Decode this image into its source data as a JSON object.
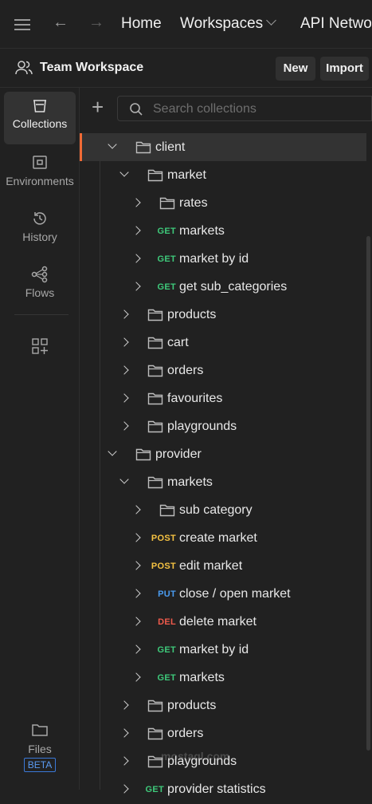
{
  "topbar": {
    "home": "Home",
    "workspaces": "Workspaces",
    "api_network": "API Network"
  },
  "workspace": {
    "name": "Team Workspace",
    "new_label": "New",
    "import_label": "Import"
  },
  "sidebar": {
    "items": [
      {
        "label": "Collections",
        "icon": "collections-icon"
      },
      {
        "label": "Environments",
        "icon": "environments-icon"
      },
      {
        "label": "History",
        "icon": "history-icon"
      },
      {
        "label": "Flows",
        "icon": "flows-icon"
      }
    ],
    "files_label": "Files",
    "beta_label": "BETA"
  },
  "search": {
    "placeholder": "Search collections"
  },
  "colors": {
    "accent": "#f06a35",
    "get": "#3ec97a",
    "post": "#f5c242",
    "put": "#4a9cf0",
    "del": "#ef5a4c"
  },
  "tree": [
    {
      "label": "client",
      "level": 0,
      "type": "folder",
      "expanded": true,
      "selected": true
    },
    {
      "label": "market",
      "level": 1,
      "type": "folder",
      "expanded": true
    },
    {
      "label": "rates",
      "level": 2,
      "type": "folder",
      "expanded": false
    },
    {
      "label": "markets",
      "level": 2,
      "type": "request",
      "method": "GET"
    },
    {
      "label": "market by id",
      "level": 2,
      "type": "request",
      "method": "GET"
    },
    {
      "label": "get sub_categories",
      "level": 2,
      "type": "request",
      "method": "GET"
    },
    {
      "label": "products",
      "level": 1,
      "type": "folder",
      "expanded": false
    },
    {
      "label": "cart",
      "level": 1,
      "type": "folder",
      "expanded": false
    },
    {
      "label": "orders",
      "level": 1,
      "type": "folder",
      "expanded": false
    },
    {
      "label": "favourites",
      "level": 1,
      "type": "folder",
      "expanded": false
    },
    {
      "label": "playgrounds",
      "level": 1,
      "type": "folder",
      "expanded": false
    },
    {
      "label": "provider",
      "level": 0,
      "type": "folder",
      "expanded": true
    },
    {
      "label": "markets",
      "level": 1,
      "type": "folder",
      "expanded": true
    },
    {
      "label": "sub category",
      "level": 2,
      "type": "folder",
      "expanded": false
    },
    {
      "label": "create market",
      "level": 2,
      "type": "request",
      "method": "POST"
    },
    {
      "label": "edit market",
      "level": 2,
      "type": "request",
      "method": "POST"
    },
    {
      "label": "close / open market",
      "level": 2,
      "type": "request",
      "method": "PUT"
    },
    {
      "label": "delete market",
      "level": 2,
      "type": "request",
      "method": "DEL"
    },
    {
      "label": "market by id",
      "level": 2,
      "type": "request",
      "method": "GET"
    },
    {
      "label": "markets",
      "level": 2,
      "type": "request",
      "method": "GET"
    },
    {
      "label": "products",
      "level": 1,
      "type": "folder",
      "expanded": false
    },
    {
      "label": "orders",
      "level": 1,
      "type": "folder",
      "expanded": false
    },
    {
      "label": "playgrounds",
      "level": 1,
      "type": "folder",
      "expanded": false
    },
    {
      "label": "provider statistics",
      "level": 1,
      "type": "request",
      "method": "GET"
    }
  ],
  "watermark": "mostaql.com"
}
